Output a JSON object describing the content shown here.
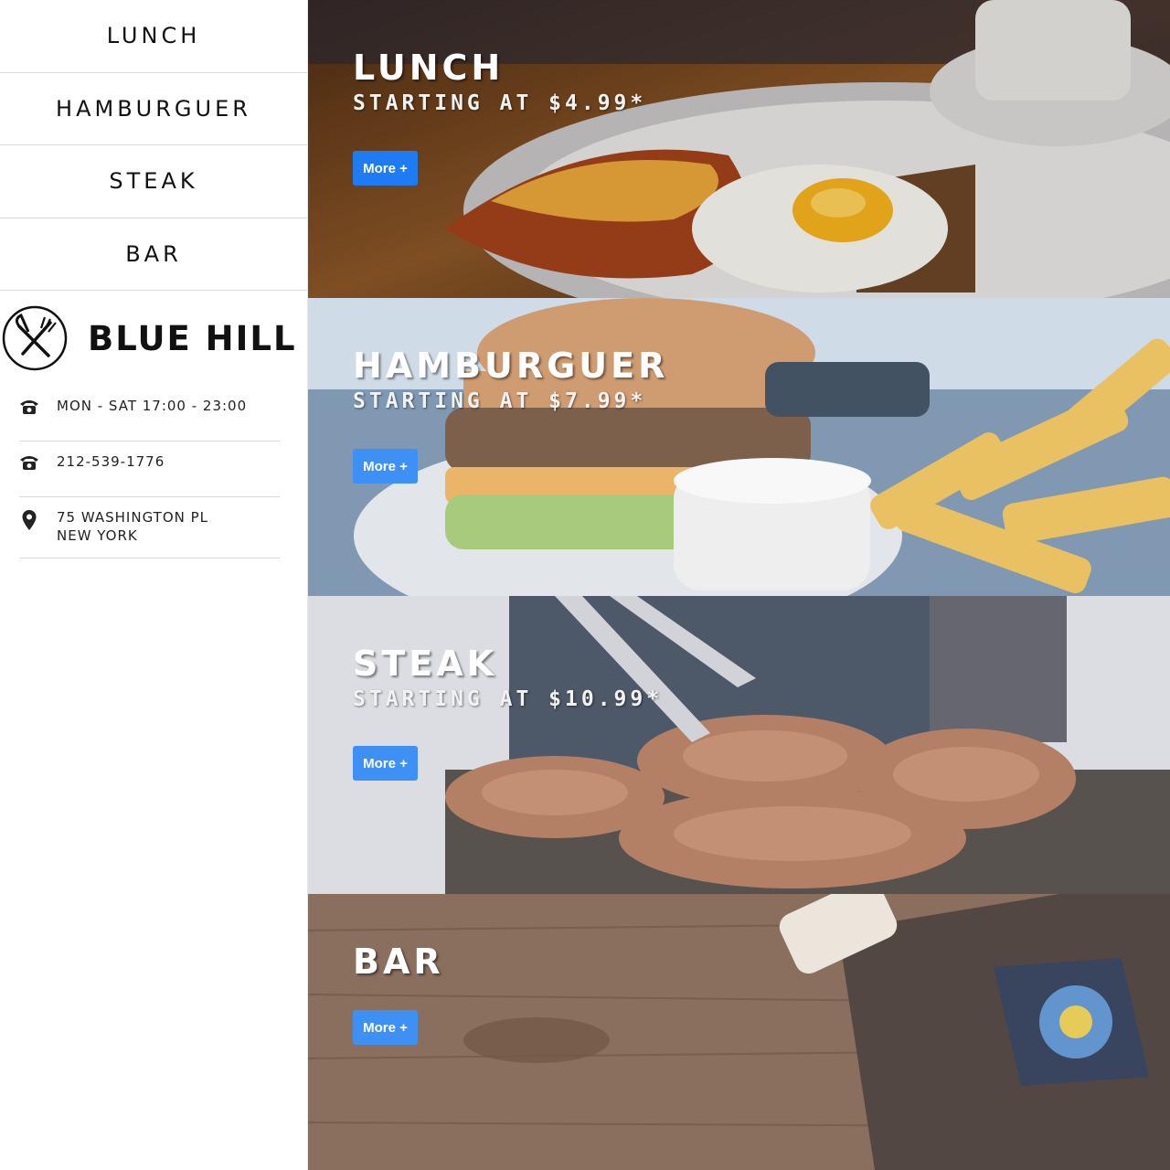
{
  "nav": {
    "items": [
      {
        "label": "LUNCH"
      },
      {
        "label": "HAMBURGUER"
      },
      {
        "label": "STEAK"
      },
      {
        "label": "BAR"
      }
    ]
  },
  "brand": {
    "name": "BLUE HILL",
    "logo_icon": "fork-knife-icon"
  },
  "info": {
    "hours": {
      "icon": "phone-icon",
      "text": "MON - SAT 17:00 - 23:00"
    },
    "phone": {
      "icon": "phone-icon",
      "text": "212-539-1776"
    },
    "address": {
      "icon": "map-pin-icon",
      "line1": "75 WASHINGTON PL",
      "line2": "NEW YORK"
    }
  },
  "panels": [
    {
      "title": "LUNCH",
      "subtitle": "STARTING AT $4.99*",
      "button": "More +"
    },
    {
      "title": "HAMBURGUER",
      "subtitle": "STARTING AT $7.99*",
      "button": "More +"
    },
    {
      "title": "STEAK",
      "subtitle": "STARTING AT $10.99*",
      "button": "More +"
    },
    {
      "title": "BAR",
      "button": "More +"
    }
  ],
  "colors": {
    "button": "#1e7bf2",
    "sidebar_bg": "#ffffff",
    "divider": "#dcdcdc"
  }
}
